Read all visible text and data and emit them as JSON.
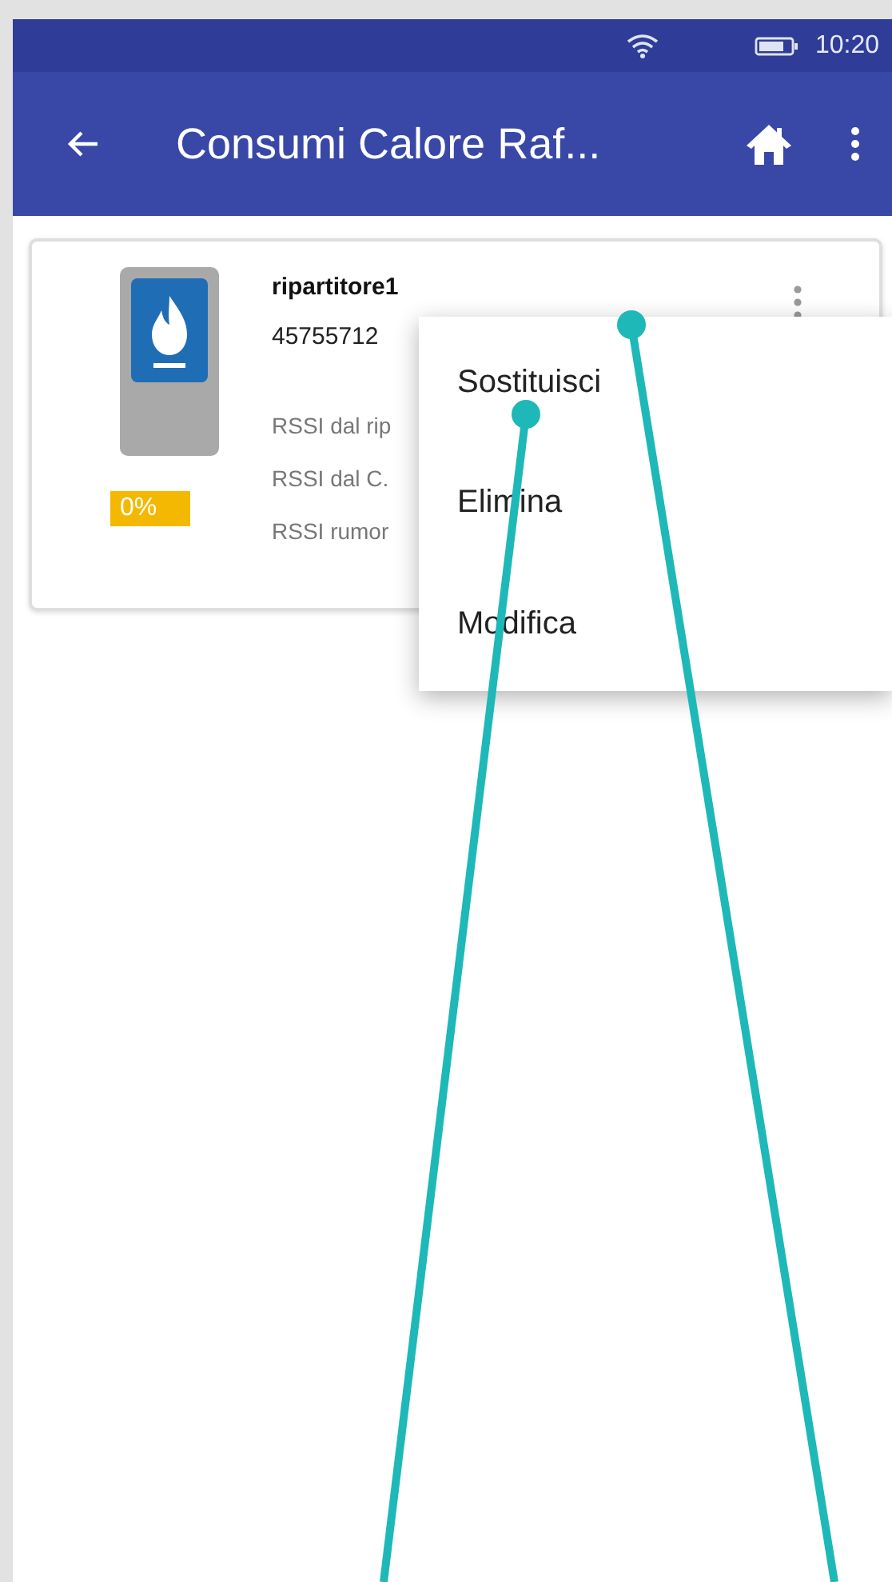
{
  "status_bar": {
    "time": "10:20"
  },
  "app_bar": {
    "title": "Consumi Calore Raf..."
  },
  "device_card": {
    "name": "ripartitore1",
    "serial": "45755712",
    "battery": "0%",
    "lines": [
      "RSSI dal rip",
      "RSSI dal C.",
      "RSSI rumor"
    ]
  },
  "popup_menu": {
    "items": [
      {
        "label": "Sostituisci"
      },
      {
        "label": "Elimina"
      },
      {
        "label": "Modifica"
      }
    ]
  }
}
